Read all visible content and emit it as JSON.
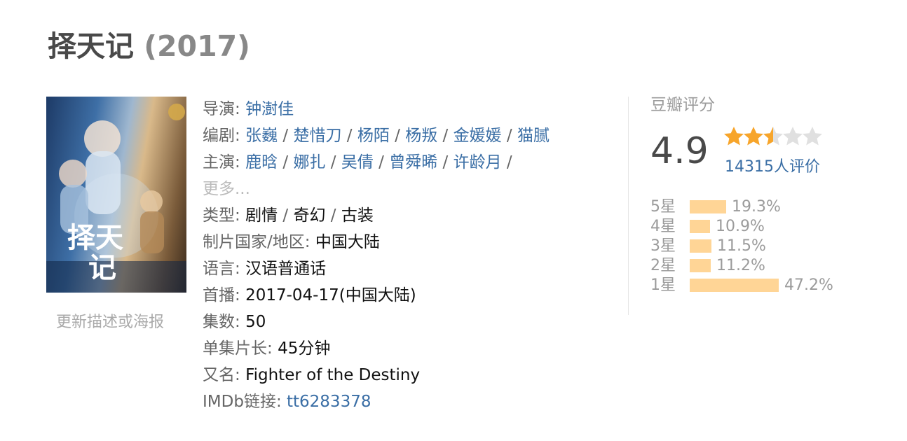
{
  "title": {
    "name": "择天记",
    "year": "(2017)"
  },
  "poster": {
    "alt_label": "择天记"
  },
  "update_link": "更新描述或海报",
  "info": {
    "director_label": "导演",
    "director": "钟澍佳",
    "writer_label": "编剧",
    "writers": [
      "张巍",
      "楚惜刀",
      "杨陌",
      "杨叛",
      "金媛媛",
      "猫腻"
    ],
    "cast_label": "主演",
    "cast": [
      "鹿晗",
      "娜扎",
      "吴倩",
      "曾舜晞",
      "许龄月"
    ],
    "cast_more": "更多...",
    "genre_label": "类型",
    "genres": [
      "剧情",
      "奇幻",
      "古装"
    ],
    "country_label": "制片国家/地区",
    "country": "中国大陆",
    "language_label": "语言",
    "language": "汉语普通话",
    "premiere_label": "首播",
    "premiere": "2017-04-17(中国大陆)",
    "episodes_label": "集数",
    "episodes": "50",
    "runtime_label": "单集片长",
    "runtime": "45分钟",
    "aka_label": "又名",
    "aka": "Fighter of the Destiny",
    "imdb_label": "IMDb链接",
    "imdb": "tt6283378"
  },
  "rating": {
    "title": "豆瓣评分",
    "score": "4.9",
    "stars_value": 2.5,
    "stars_max": 5,
    "votes": "14315人评价",
    "star_color": "#f7a52b",
    "star_empty_color": "#e0e0e0",
    "bar_color": "#ffd596",
    "distribution": [
      {
        "label": "5星",
        "pct": "19.3%",
        "value": 19.3
      },
      {
        "label": "4星",
        "pct": "10.9%",
        "value": 10.9
      },
      {
        "label": "3星",
        "pct": "11.5%",
        "value": 11.5
      },
      {
        "label": "2星",
        "pct": "11.2%",
        "value": 11.2
      },
      {
        "label": "1星",
        "pct": "47.2%",
        "value": 47.2
      }
    ]
  }
}
